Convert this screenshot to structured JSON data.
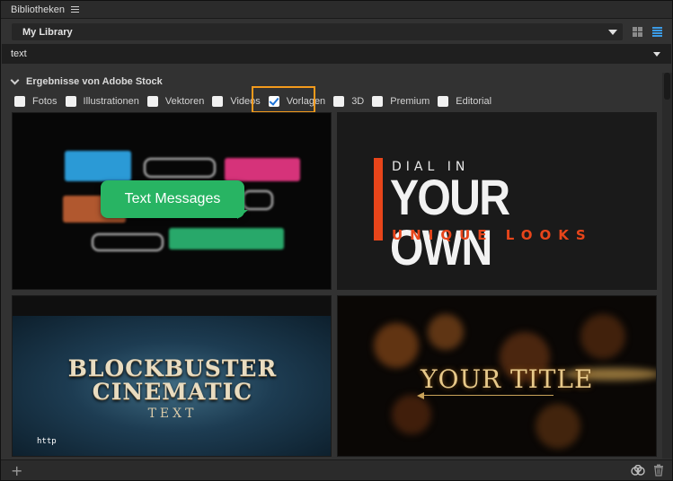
{
  "header": {
    "title": "Bibliotheken",
    "menu_icon": "hamburger-icon"
  },
  "library": {
    "selected": "My Library"
  },
  "view_toggles": {
    "grid_icon": "grid-view-icon",
    "list_icon": "list-view-icon",
    "active": "list",
    "accent": "#3b9be6"
  },
  "search": {
    "value": "text"
  },
  "section": {
    "title": "Ergebnisse von Adobe Stock"
  },
  "filters": [
    {
      "label": "Fotos",
      "checked": false
    },
    {
      "label": "Illustrationen",
      "checked": false
    },
    {
      "label": "Vektoren",
      "checked": false
    },
    {
      "label": "Videos",
      "checked": false
    },
    {
      "label": "Vorlagen",
      "checked": true
    },
    {
      "label": "3D",
      "checked": false
    },
    {
      "label": "Premium",
      "checked": false
    },
    {
      "label": "Editorial",
      "checked": false
    }
  ],
  "highlight_color": "#f39a1c",
  "results": {
    "t1": {
      "bubble": "Text Messages",
      "accent": "#28b463"
    },
    "t2": {
      "line1": "DIAL IN",
      "line2": "YOUR OWN",
      "line3": "UNIQUE LOOKS",
      "accent": "#e8451a"
    },
    "t3": {
      "line1": "BLOCKBUSTER",
      "line2": "CINEMATIC",
      "line3": "TEXT",
      "overlay": "http"
    },
    "t4": {
      "line1": "YOUR TITLE"
    }
  },
  "footer": {
    "add_icon": "plus-icon",
    "cloud_icon": "creative-cloud-icon",
    "trash_icon": "trash-icon"
  }
}
